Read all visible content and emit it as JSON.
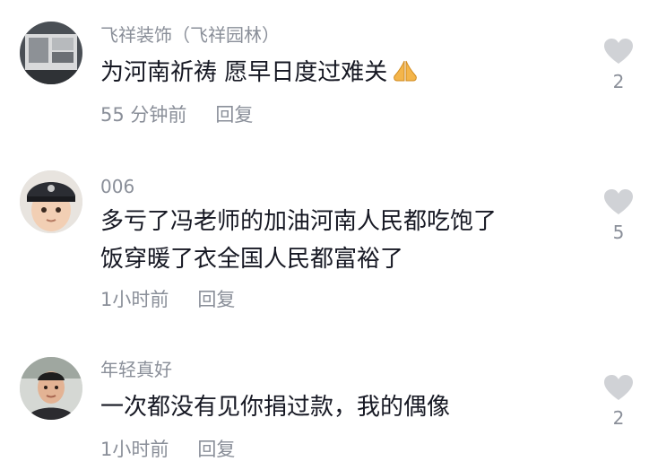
{
  "comments": [
    {
      "username": "飞祥装饰（飞祥园林）",
      "lines": [
        "为河南祈祷 愿早日度过难关"
      ],
      "emoji": "folded-hands",
      "time": "55 分钟前",
      "reply_label": "回复",
      "likes": "2"
    },
    {
      "username": "006",
      "lines": [
        "多亏了冯老师的加油河南人民都吃饱了",
        "饭穿暖了衣全国人民都富裕了"
      ],
      "time": "1小时前",
      "reply_label": "回复",
      "likes": "5"
    },
    {
      "username": "年轻真好",
      "lines": [
        "一次都没有见你捐过款，我的偶像"
      ],
      "time": "1小时前",
      "reply_label": "回复",
      "likes": "2"
    }
  ],
  "colors": {
    "text": "#161823",
    "secondary": "#8a8f99",
    "heart": "#d0d2d6"
  }
}
